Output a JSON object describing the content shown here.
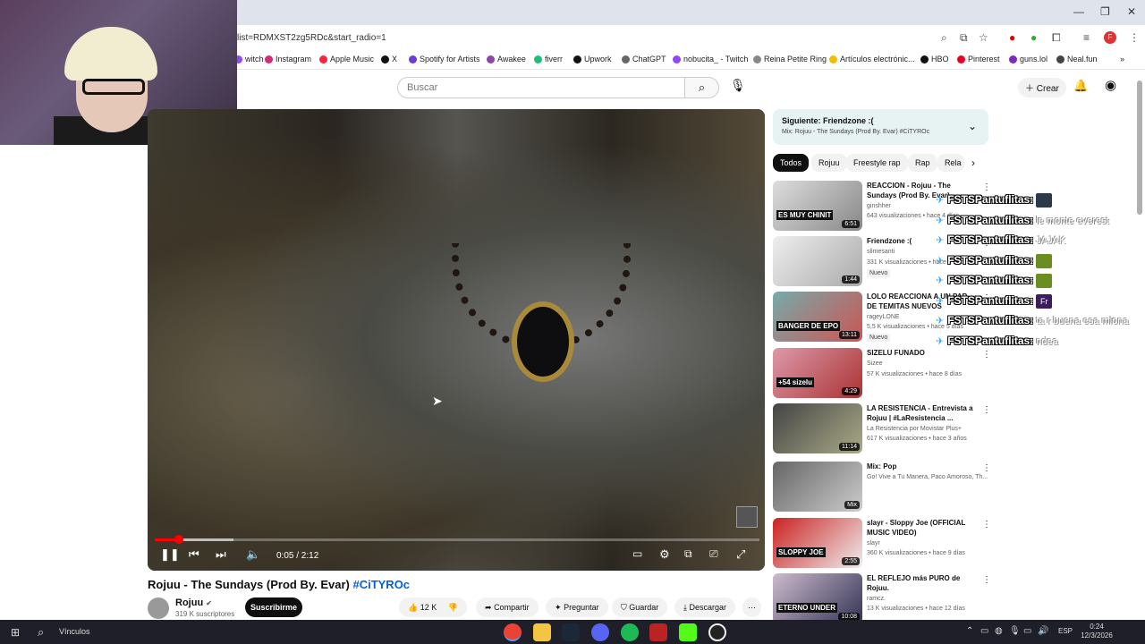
{
  "browser": {
    "url": "list=RDMXST2zg5RDc&start_radio=1",
    "bookmarks": [
      {
        "label": "witch",
        "color": "#9146ff"
      },
      {
        "label": "Instagram",
        "color": "#d62976"
      },
      {
        "label": "Apple Music",
        "color": "#fa243c"
      },
      {
        "label": "X",
        "color": "#111111"
      },
      {
        "label": "Spotify for Artists",
        "color": "#6e3bd9"
      },
      {
        "label": "Awakee",
        "color": "#8e44ad"
      },
      {
        "label": "fiverr",
        "color": "#1dbf73"
      },
      {
        "label": "Upwork",
        "color": "#111111"
      },
      {
        "label": "ChatGPT",
        "color": "#666666"
      },
      {
        "label": "nobucita_ - Twitch",
        "color": "#9146ff"
      },
      {
        "label": "Reina Petite Ring",
        "color": "#888888"
      },
      {
        "label": "Artículos electrónic...",
        "color": "#f0c000"
      },
      {
        "label": "HBO",
        "color": "#111111"
      },
      {
        "label": "Pinterest",
        "color": "#e60023"
      },
      {
        "label": "guns.lol",
        "color": "#7b2cbf"
      },
      {
        "label": "Neal.fun",
        "color": "#444444"
      }
    ],
    "profile_initial": "F"
  },
  "header": {
    "search_placeholder": "Buscar",
    "create_label": "Crear"
  },
  "player": {
    "time_display": "0:05 / 2:12",
    "progress_fraction": 0.04,
    "buffer_fraction": 0.13
  },
  "video": {
    "title": "Rojuu - The Sundays (Prod By. Evar)",
    "hashtag": "#CiTYROc",
    "channel": "Rojuu",
    "subscribers": "319 K suscriptores",
    "subscribe_label": "Suscribirme",
    "likes": "12 K",
    "share_label": "Compartir",
    "ask_label": "Preguntar",
    "save_label": "Guardar",
    "download_label": "Descargar"
  },
  "up_next": {
    "label": "Siguiente: Friendzone :(",
    "sub": "Mix: Rojuu - The Sundays (Prod By. Evar) #CiTYROc"
  },
  "chips": [
    "Todos",
    "Rojuu",
    "Freestyle rap",
    "Rap",
    "Rela"
  ],
  "recommendations": [
    {
      "title": "REACCION - Rojuu - The Sundays (Prod By. Evar)",
      "channel": "ginshher",
      "meta": "643 visualizaciones • hace 4 días",
      "duration": "6:51",
      "thumb_text": "ES MUY CHINIT",
      "badge": ""
    },
    {
      "title": "Friendzone :(",
      "channel": "slimesanti",
      "meta": "331 K visualizaciones • hace 1 año",
      "duration": "1:44",
      "thumb_text": "",
      "badge": "Nuevo"
    },
    {
      "title": "LOLO REACCIONA A UN PAR DE TEMITAS NUEVOS",
      "channel": "rageyLONE",
      "meta": "5,5 K visualizaciones • hace 5 días",
      "duration": "13:11",
      "thumb_text": "BANGER DE EPO",
      "badge": "Nuevo"
    },
    {
      "title": "SIZELU FUNADO",
      "channel": "Sizee",
      "meta": "57 K visualizaciones • hace 8 días",
      "duration": "4:29",
      "thumb_text": "+54 sizelu",
      "badge": ""
    },
    {
      "title": "LA RESISTENCIA - Entrevista a Rojuu | #LaResistencia ...",
      "channel": "La Resistencia por Movistar Plus+",
      "meta": "617 K visualizaciones • hace 3 años",
      "duration": "11:14",
      "thumb_text": "",
      "badge": ""
    },
    {
      "title": "Mix: Pop",
      "channel": "Go! Vive a Tu Manera, Paco Amoroso, Th...",
      "meta": "",
      "duration": "Mix",
      "thumb_text": "",
      "badge": ""
    },
    {
      "title": "slayr - Sloppy Joe (OFFICIAL MUSIC VIDEO)",
      "channel": "slayr",
      "meta": "360 K visualizaciones • hace 9 días",
      "duration": "2:55",
      "thumb_text": "SLOPPY JOE",
      "badge": ""
    },
    {
      "title": "EL REFLEJO más PURO de Rojuu.",
      "channel": "ramcz.",
      "meta": "13 K visualizaciones • hace 12 días",
      "duration": "10:08",
      "thumb_text": "ETERNO UNDER",
      "badge": ""
    }
  ],
  "chat": [
    {
      "name": "FSTSPantuflitas",
      "msg": "",
      "emote_color": "#2a3a4a"
    },
    {
      "name": "FSTSPantuflitas",
      "msg": "le monte everest",
      "emote_color": ""
    },
    {
      "name": "FSTSPantuflitas",
      "msg": "JAJAK",
      "emote_color": ""
    },
    {
      "name": "FSTSPantuflitas",
      "msg": "",
      "emote_color": "#6b8e23"
    },
    {
      "name": "FSTSPantuflitas",
      "msg": "",
      "emote_color": "#6b8e23"
    },
    {
      "name": "FSTSPantuflitas",
      "msg": "",
      "emote_color": "#3a1f5c",
      "emote_text": "Fr"
    },
    {
      "name": "FSTSPantuflitas",
      "msg": "ta r buena esa mlona",
      "emote_color": ""
    },
    {
      "name": "FSTSPantuflitas",
      "msg": "ndea",
      "emote_color": ""
    }
  ],
  "taskbar": {
    "links_label": "Vínculos",
    "lang": "ESP",
    "time": "0:24",
    "date": "12/3/2026"
  }
}
